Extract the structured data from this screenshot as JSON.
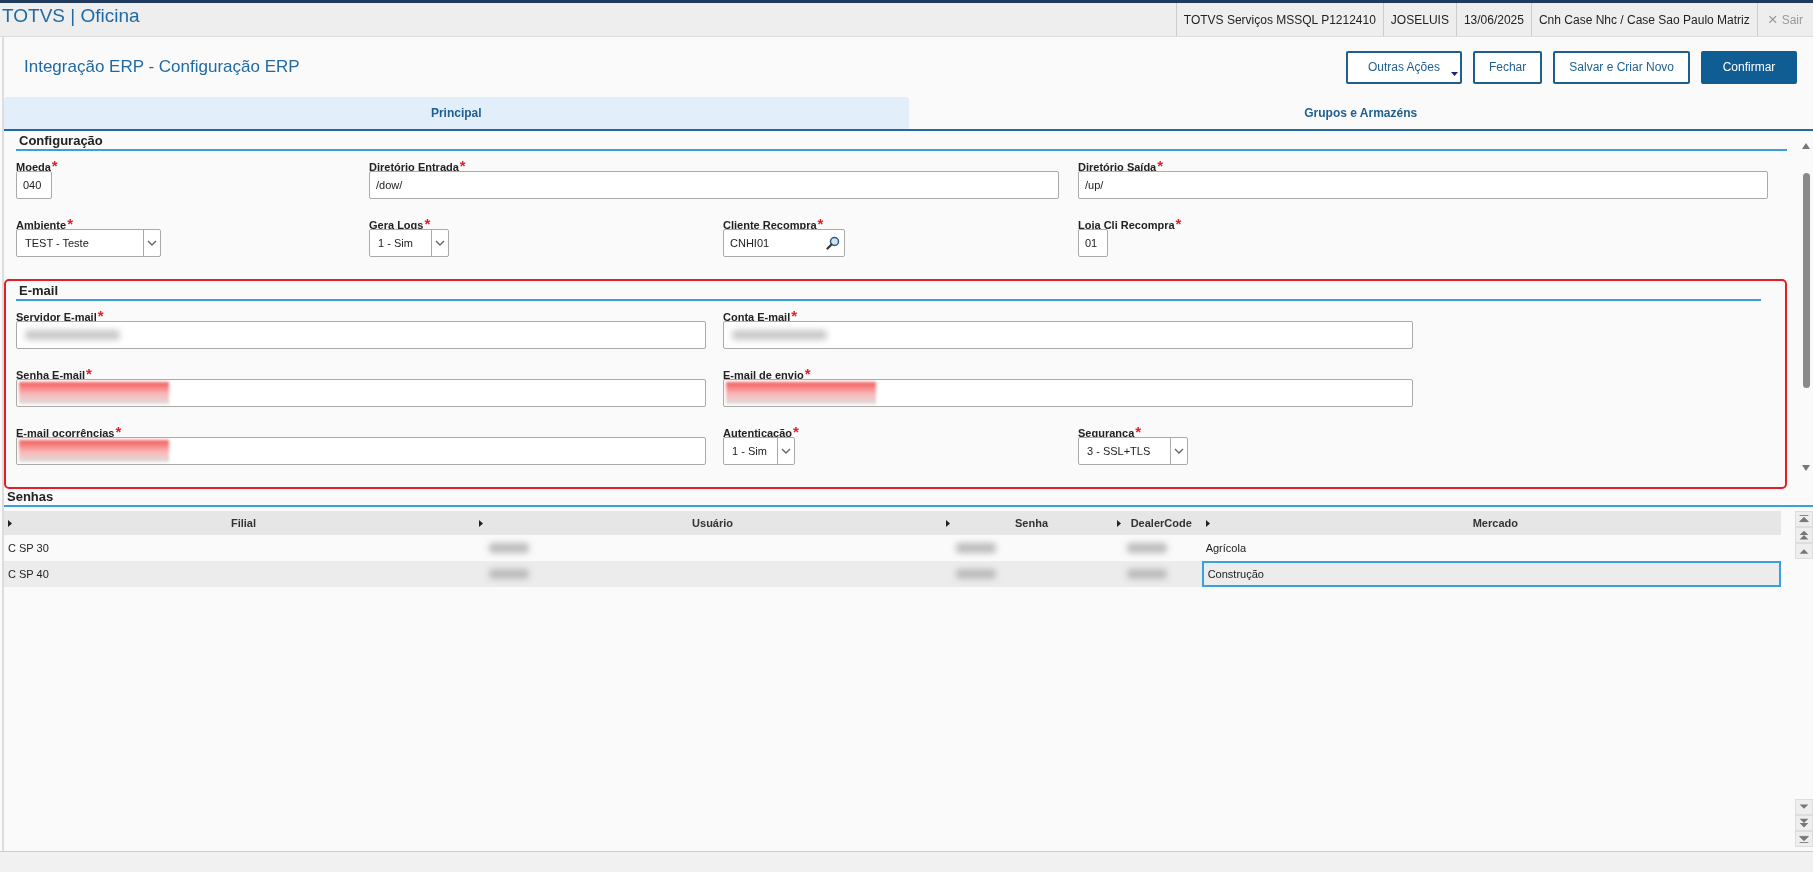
{
  "app_title": "TOTVS | Oficina",
  "status_items": [
    "TOTVS Serviços MSSQL P1212410",
    "JOSELUIS",
    "13/06/2025",
    "Cnh Case Nhc / Case Sao Paulo Matriz"
  ],
  "exit": {
    "icon": "×",
    "label": "Sair",
    "disabled": true
  },
  "page_title": "Integração ERP - Configuração ERP",
  "actions": [
    {
      "label": "Outras Ações",
      "kind": "menu"
    },
    {
      "label": "Fechar",
      "kind": "plain"
    },
    {
      "label": "Salvar e Criar Novo",
      "kind": "plain"
    },
    {
      "label": "Confirmar",
      "kind": "primary"
    }
  ],
  "tabs": [
    {
      "label": "Principal",
      "selected": true
    },
    {
      "label": "Grupos e Armazéns",
      "selected": false
    }
  ],
  "sections": [
    {
      "title": "Configuração",
      "highlighted": false,
      "rows": [
        [
          {
            "label": "Moeda",
            "required_mark": "*",
            "kind": "text",
            "value": "040"
          },
          {
            "label": "Diretório Entrada",
            "required_mark": "*",
            "kind": "text",
            "value": "/dow/"
          },
          "",
          {
            "label": "Diretório Saída",
            "required_mark": "*",
            "kind": "text",
            "value": "/up/"
          }
        ],
        [
          {
            "label": "Ambiente",
            "required_mark": "*",
            "kind": "select",
            "value": "TEST - Teste"
          },
          {
            "label": "Gera Logs",
            "required_mark": "*",
            "kind": "select",
            "value": "1 - Sim"
          },
          {
            "label": "Cliente Recompra",
            "required_mark": "*",
            "kind": "lookup",
            "value": "CNHI01"
          },
          {
            "label": "Loja Cli Recompra",
            "required_mark": "*",
            "kind": "text",
            "value": "01"
          }
        ]
      ]
    },
    {
      "title": "E-mail",
      "highlighted": true,
      "rows": [
        [
          {
            "label": "Servidor E-mail",
            "required_mark": "*",
            "kind": "text",
            "blurred": true
          },
          {
            "label": "Conta E-mail",
            "required_mark": "*",
            "kind": "text",
            "blurred": true
          }
        ],
        [
          {
            "label": "Senha E-mail",
            "required_mark": "*",
            "kind": "text",
            "redacted": true
          },
          {
            "label": "E-mail de envio",
            "required_mark": "*",
            "kind": "text",
            "redacted": true
          }
        ],
        [
          {
            "label": "E-mail ocorrências",
            "required_mark": "*",
            "kind": "text",
            "redacted": true
          },
          {
            "label": "Autenticação",
            "required_mark": "*",
            "kind": "select",
            "value": "1 - Sim"
          },
          {
            "label": "Segurança",
            "required_mark": "*",
            "kind": "select",
            "value": "3 - SSL+TLS"
          }
        ]
      ]
    }
  ],
  "grid": {
    "title": "Senhas",
    "columns": [
      "Filial",
      "Usuário",
      "Senha",
      "DealerCode",
      "Mercado"
    ],
    "rows": [
      {
        "filial": "C SP 30",
        "blurred": true,
        "mercado": "Agrícola",
        "selected": false
      },
      {
        "filial": "C SP 40",
        "blurred": true,
        "mercado": "Construção",
        "selected": true
      }
    ]
  }
}
